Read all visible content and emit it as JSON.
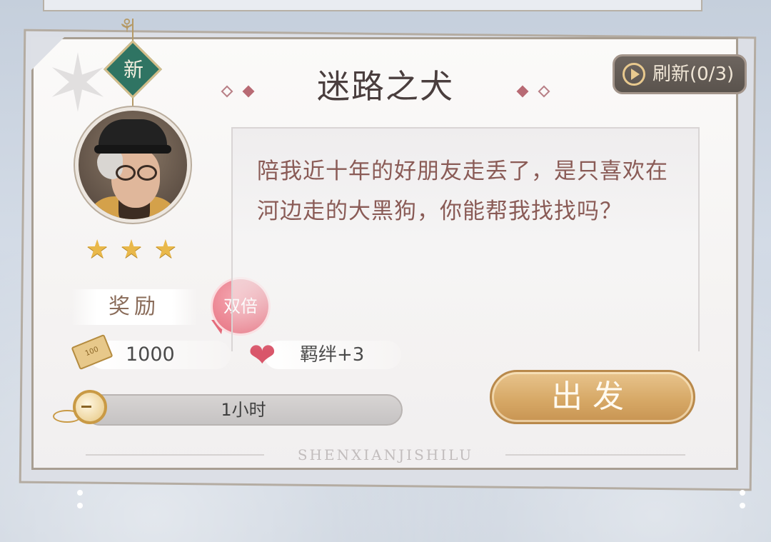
{
  "badge": {
    "new_label": "新"
  },
  "rating": {
    "stars": 3,
    "max": 3
  },
  "quest": {
    "title": "迷路之犬",
    "description": "陪我近十年的好朋友走丢了，是只喜欢在河边走的大黑狗，你能帮我找找吗？"
  },
  "refresh": {
    "label": "刷新(0/3)"
  },
  "reward": {
    "label": "奖励",
    "double_label": "双倍",
    "money_value": "1000",
    "money_icon_text": "100",
    "bond_value": "羁绊+3"
  },
  "duration": {
    "label": "1小时"
  },
  "action": {
    "depart_label": "出发"
  },
  "footer": {
    "watermark": "SHENXIANJISHILU"
  },
  "icons": {
    "new": "new-diamond-badge",
    "refresh": "play-circle-icon",
    "money": "banknote-icon",
    "bond": "heart-icon",
    "time": "pocket-watch-icon",
    "star": "star-icon"
  },
  "colors": {
    "title": "#4a3e3e",
    "description": "#8a5b56",
    "depart_button": "#d7a967",
    "double_badge": "#e46b7b",
    "new_badge": "#2f7463"
  }
}
